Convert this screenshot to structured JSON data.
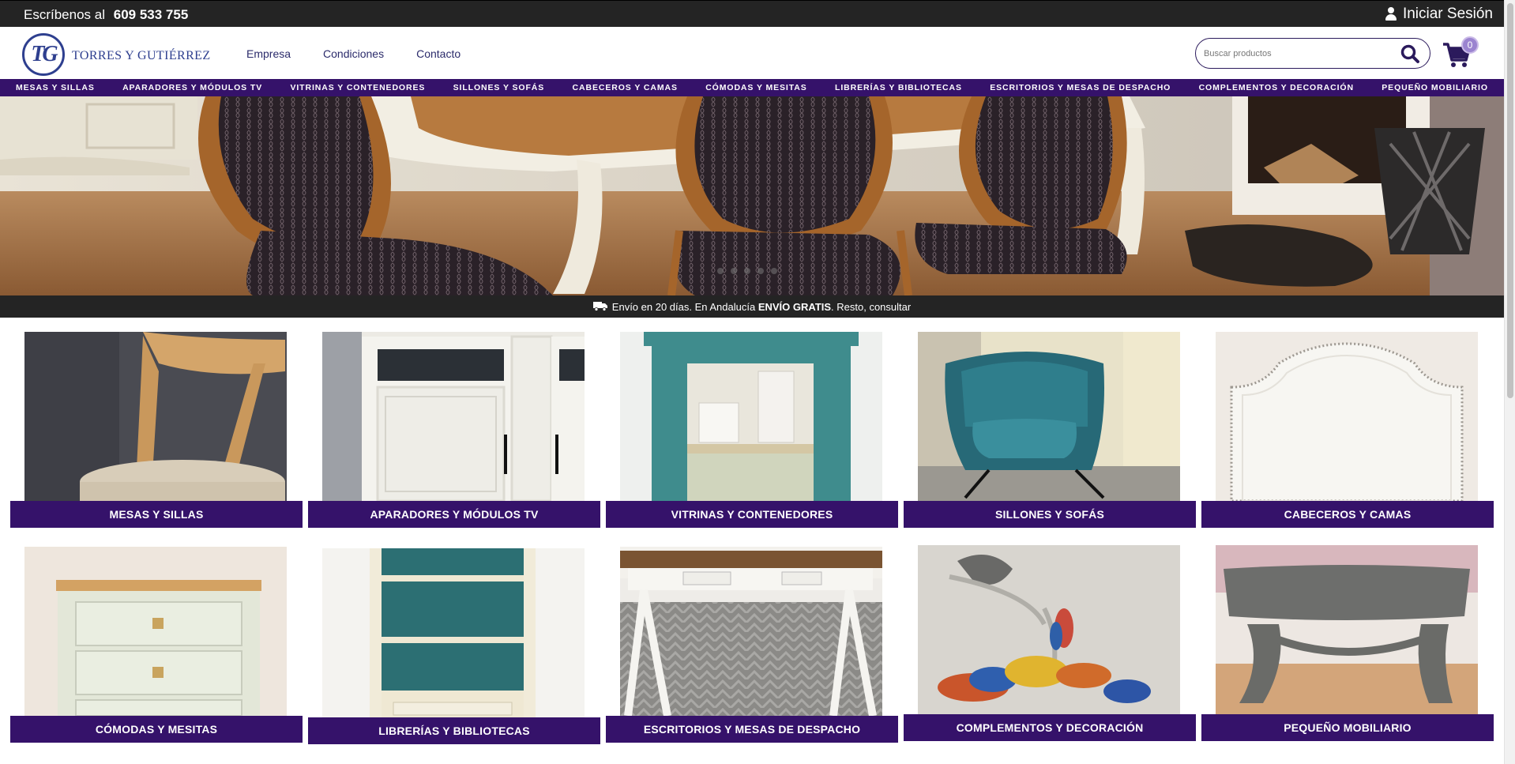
{
  "topbar": {
    "phone_prefix": "Escríbenos al",
    "phone_number": "609 533 755",
    "login_label": "Iniciar Sesión"
  },
  "brand": {
    "logo_initials": "TG",
    "name": "TORRES Y GUTIÉRREZ"
  },
  "header_nav": {
    "items": [
      "Empresa",
      "Condiciones",
      "Contacto"
    ]
  },
  "search": {
    "placeholder": "Buscar productos",
    "value": ""
  },
  "cart": {
    "count": "0"
  },
  "category_nav": {
    "items": [
      "MESAS Y SILLAS",
      "APARADORES Y MÓDULOS TV",
      "VITRINAS Y CONTENEDORES",
      "SILLONES Y SOFÁS",
      "CABECEROS Y CAMAS",
      "CÓMODAS Y MESITAS",
      "LIBRERÍAS Y BIBLIOTECAS",
      "ESCRITORIOS Y MESAS DE DESPACHO",
      "COMPLEMENTOS Y DECORACIÓN",
      "PEQUEÑO MOBILIARIO"
    ]
  },
  "shipping": {
    "prefix": "Envío en 20 días. En Andalucía ",
    "highlight": "ENVÍO GRATIS",
    "suffix": ". Resto, consultar"
  },
  "categories": [
    {
      "label": "MESAS Y SILLAS",
      "image": "wooden-chair"
    },
    {
      "label": "APARADORES Y MÓDULOS TV",
      "image": "white-sideboard"
    },
    {
      "label": "VITRINAS Y CONTENEDORES",
      "image": "teal-display-cabinet"
    },
    {
      "label": "SILLONES Y SOFÁS",
      "image": "teal-velvet-armchair"
    },
    {
      "label": "CABECEROS Y CAMAS",
      "image": "white-headboard"
    },
    {
      "label": "CÓMODAS Y MESITAS",
      "image": "chest-of-drawers"
    },
    {
      "label": "LIBRERÍAS Y BIBLIOTECAS",
      "image": "bookcase"
    },
    {
      "label": "ESCRITORIOS Y MESAS DE DESPACHO",
      "image": "desk"
    },
    {
      "label": "COMPLEMENTOS Y DECORACIÓN",
      "image": "glass-sculpture"
    },
    {
      "label": "PEQUEÑO MOBILIARIO",
      "image": "upholstered-bench"
    }
  ],
  "colors": {
    "brand_purple": "#35126a",
    "dark_bar": "#242424",
    "logo_blue": "#2e3f8f"
  }
}
